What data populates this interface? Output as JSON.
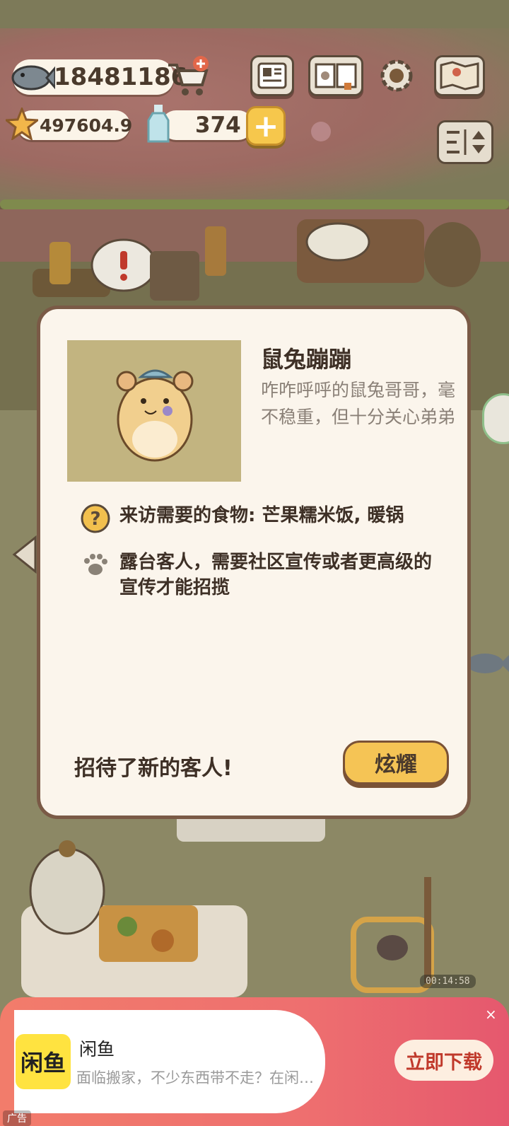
{
  "hud": {
    "fish_count": "18481186",
    "star_count": "497604.9",
    "bottle_count": "374",
    "icons": [
      "fish-icon",
      "shop-cart-plus-icon",
      "star-icon",
      "bottle-icon",
      "plus-icon",
      "newspaper-icon",
      "album-book-icon",
      "gear-icon",
      "map-icon",
      "sort-toggle-icon"
    ]
  },
  "dialog": {
    "name": "鼠兔蹦蹦",
    "description": "咋咋呼呼的鼠兔哥哥，毫不稳重，但十分关心弟弟",
    "food_requirement": "来访需要的食物: 芒果糯米饭, 暖锅",
    "attract_requirement": "露台客人，需要社区宣传或者更高级的宣传才能招揽",
    "status_text": "招待了新的客人!",
    "show_off_label": "炫耀"
  },
  "scene": {
    "timer": "00:14:58"
  },
  "ad": {
    "app_name": "闲鱼",
    "logo_text": "闲鱼",
    "subtitle": "面临搬家，不少东西带不走？在闲…",
    "cta_label": "立即下载",
    "close_label": "×",
    "ad_tag": "广告"
  },
  "colors": {
    "accent_yellow": "#f5c455",
    "dialog_bg": "#fbf5ec",
    "dialog_border": "#7a5a46",
    "ad_gradient": "#ee6f6f"
  }
}
